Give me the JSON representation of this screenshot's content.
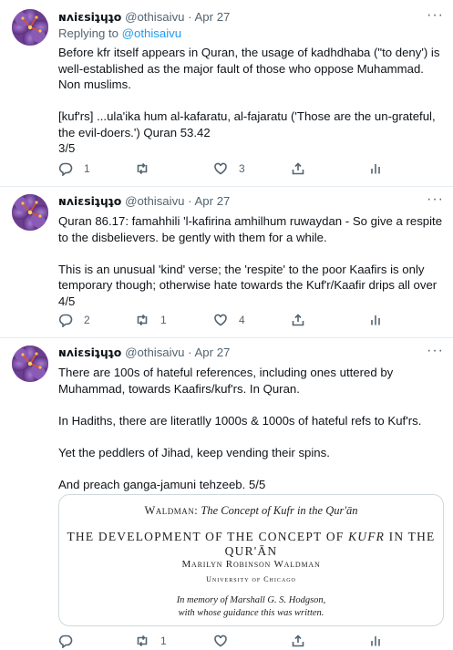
{
  "tweets": [
    {
      "display_name": "ɴʌiɛsiʇɥʇo",
      "handle": "@othisaivu",
      "separator": "·",
      "date": "Apr 27",
      "replying_prefix": "Replying to ",
      "replying_to": "@othisaivu",
      "text": "Before kfr itself appears in Quran, the usage of kadhdhaba (\"to deny') is well-established as the major fault of those who oppose Muhammad. Non muslims.\n\n[kuf'rs] ...ula'ika hum al-kafaratu, al-fajaratu ('Those are the un-grateful, the evil-doers.') Quran 53.42\n3/5",
      "replies": "1",
      "retweets": "",
      "likes": "3"
    },
    {
      "display_name": "ɴʌiɛsiʇɥʇo",
      "handle": "@othisaivu",
      "separator": "·",
      "date": "Apr 27",
      "text": "Quran 86.17: famahhili 'l-kafirina amhilhum ruwaydan - So give a respite to the disbelievers. be gently with them for a while.\n\nThis is an unusual 'kind' verse; the 'respite' to the poor Kaafirs is only temporary though; otherwise hate towards the Kuf'r/Kaafir drips all over 4/5",
      "replies": "2",
      "retweets": "1",
      "likes": "4"
    },
    {
      "display_name": "ɴʌiɛsiʇɥʇo",
      "handle": "@othisaivu",
      "separator": "·",
      "date": "Apr 27",
      "text": "There are 100s of hateful references, including ones uttered by Muhammad, towards Kaafirs/kuf'rs. In Quran.\n\nIn Hadiths, there are literatlly 1000s & 1000s of hateful refs to Kuf'rs.\n\nYet the peddlers of Jihad, keep vending their spins.\n\nAnd preach ganga-jamuni tehzeeb. 5/5",
      "replies": "",
      "retweets": "1",
      "likes": "",
      "media": {
        "header_author": "Waldman:",
        "header_title": "The Concept of Kufr in the Qur'ān",
        "title_main": "THE DEVELOPMENT OF THE CONCEPT OF ",
        "title_kufr": "KUFR",
        "title_end": " IN THE QUR'ĀN",
        "author": "Marilyn Robinson Waldman",
        "affiliation": "University of Chicago",
        "dedication": "In memory of Marshall G. S. Hodgson,\nwith whose guidance this was written."
      }
    }
  ],
  "icons": {
    "reply": "reply-icon",
    "retweet": "retweet-icon",
    "like": "heart-icon",
    "share": "share-icon",
    "analytics": "analytics-icon",
    "more": "more-icon"
  },
  "colors": {
    "text": "#0f1419",
    "secondary": "#536471",
    "link": "#1d9bf0",
    "divider": "#e6ecf0",
    "avatar_bg": "#5a2d7a",
    "avatar_accent": "#e8b64a"
  }
}
